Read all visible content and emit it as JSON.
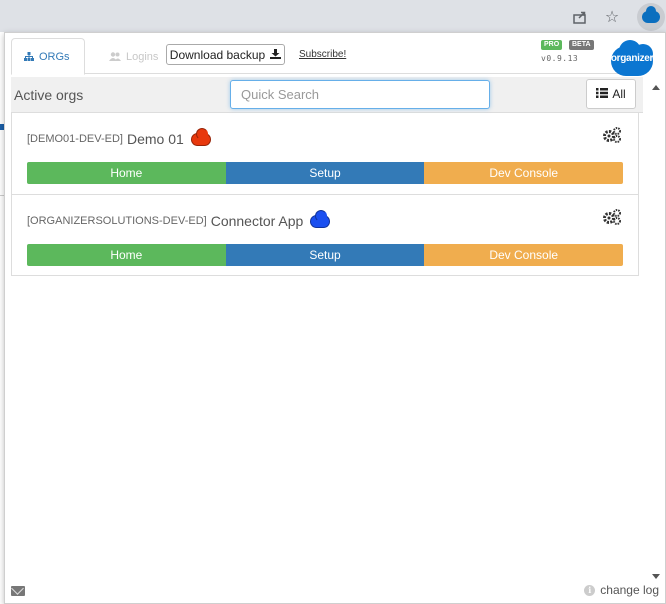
{
  "browser": {
    "icons": [
      "share-icon",
      "star-icon",
      "organizer-extension-icon"
    ]
  },
  "tabs": [
    {
      "label": "ORGs",
      "icon": "sitemap-icon",
      "active": true
    },
    {
      "label": "Logins",
      "icon": "users-icon",
      "active": false
    }
  ],
  "toolbar": {
    "download_label": "Download backup",
    "subscribe_label": "Subscribe!",
    "badge_pro": "PRO",
    "badge_beta": "BETA",
    "version": "v0.9.13",
    "logo_text": "organizer"
  },
  "filter": {
    "label": "Active orgs",
    "search_placeholder": "Quick Search",
    "all_label": "All"
  },
  "orgs": [
    {
      "id": "[DEMO01-DEV-ED]",
      "name": "Demo 01",
      "cloud_color": "#e8380d",
      "buttons": {
        "home": "Home",
        "setup": "Setup",
        "dev": "Dev Console"
      }
    },
    {
      "id": "[ORGANIZERSOLUTIONS-DEV-ED]",
      "name": "Connector App",
      "cloud_color": "#1a4ff0",
      "buttons": {
        "home": "Home",
        "setup": "Setup",
        "dev": "Dev Console"
      }
    }
  ],
  "footer": {
    "changelog_label": "change log"
  },
  "colors": {
    "home": "#5cb85c",
    "setup": "#337ab7",
    "dev": "#f0ad4e",
    "accent": "#337ab7"
  }
}
